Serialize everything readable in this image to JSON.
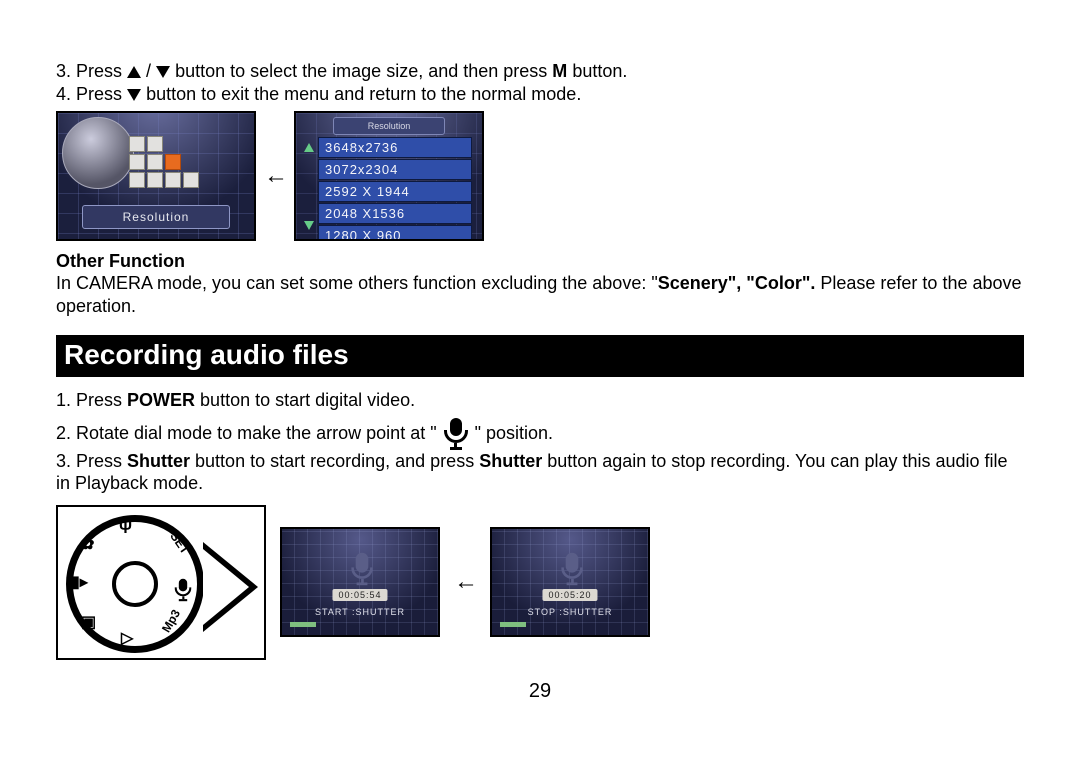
{
  "step3_a": "3. Press ",
  "step3_b": " button to select the image size, and then press ",
  "step3_m": "M",
  "step3_c": " button.",
  "step4_a": "4. Press",
  "step4_b": "button to exit the menu and return to the normal mode.",
  "screen1": {
    "label": "Resolution"
  },
  "screen2": {
    "header": "Resolution",
    "items": [
      "3648x2736",
      "3072x2304",
      "2592 X 1944",
      "2048 X1536",
      "1280 X 960"
    ]
  },
  "other_function_heading": "Other Function",
  "other_function_a": "In CAMERA mode, you can set some others function excluding the above: \"",
  "other_function_b1": "Scenery\", \"Color\".",
  "other_function_c": " Please refer to the above operation.",
  "section_title": "Recording audio files",
  "rec1_a": "1. Press ",
  "rec1_power": "POWER",
  "rec1_b": " button to start digital video.",
  "rec2_a": "2. Rotate dial mode to make the arrow point at \"",
  "rec2_b": "\" position.",
  "rec3_a": "3. Press ",
  "rec3_sh": "Shutter",
  "rec3_b": " button to start recording, and press ",
  "rec3_c": " button again to stop recording. You can play this audio file in Playback mode.",
  "dial": {
    "labels": [
      "SET",
      "Mp3"
    ]
  },
  "rec_screens": [
    {
      "time": "00:05:54",
      "label": "START :SHUTTER"
    },
    {
      "time": "00:05:20",
      "label": "STOP :SHUTTER"
    }
  ],
  "page_number": "29"
}
